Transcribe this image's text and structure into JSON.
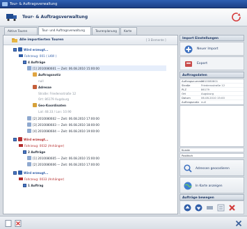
{
  "window": {
    "title": "Tour- & Auftragsverwaltung"
  },
  "header": {
    "title": "Tour- & Auftragsverwaltung"
  },
  "tabs": [
    {
      "label": "Aktive Touren"
    },
    {
      "label": "Tour- und Auftragsverwaltung"
    },
    {
      "label": "Tourenplanung"
    },
    {
      "label": "Karte"
    }
  ],
  "panel": {
    "title": "Alle importierten Touren",
    "tag": "[ 3 Elemente ]"
  },
  "tree": [
    {
      "text": "Wird erzeugt...",
      "cls": "blue bold"
    },
    {
      "text": "Fahrzeug: 001 ( LKW )",
      "cls": "blue"
    },
    {
      "text": "4 Aufträge",
      "cls": "bold"
    },
    {
      "text": "[1] 2010080601 — Zeit: 06.08.2010 15:00:00",
      "cls": ""
    },
    {
      "text": "Auftragsnotiz",
      "cls": "bold"
    },
    {
      "text": "null",
      "cls": "grey"
    },
    {
      "text": "Adresse",
      "cls": "bold"
    },
    {
      "text": "Straße: Friedensstraße 12",
      "cls": "grey"
    },
    {
      "text": "Ort: 86179 Augsburg",
      "cls": "grey"
    },
    {
      "text": "Geo-Koordinaten",
      "cls": "bold"
    },
    {
      "text": "Lat: 48.33 / Lon: 10.90",
      "cls": "grey"
    },
    {
      "text": "[2] 2010080602 — Zeit: 06.08.2010 17:00:00",
      "cls": ""
    },
    {
      "text": "[3] 2010080603 — Zeit: 06.08.2010 18:00:00",
      "cls": ""
    },
    {
      "text": "[4] 2010080604 — Zeit: 06.08.2010 19:00:00",
      "cls": ""
    },
    {
      "text": "Wird erzeugt...",
      "cls": "red bold"
    },
    {
      "text": "Fahrzeug: 0032 (Anhänger)",
      "cls": "red"
    },
    {
      "text": "2 Aufträge",
      "cls": "bold"
    },
    {
      "text": "[1] 2010080605 — Zeit: 06.08.2010 15:00:00",
      "cls": ""
    },
    {
      "text": "[2] 2010080606 — Zeit: 06.08.2010 17:00:00",
      "cls": ""
    },
    {
      "text": "Wird erzeugt...",
      "cls": "blue bold"
    },
    {
      "text": "Fahrzeug: 0033 (Anhänger)",
      "cls": "red"
    },
    {
      "text": "1 Auftrag",
      "cls": "bold"
    }
  ],
  "side": {
    "import_head": "Import Einstellungen",
    "new_import": "Neuer Import",
    "export": "Export",
    "details_head": "Auftragsdaten",
    "details": [
      {
        "k": "Auftragsnummer",
        "v": "2010080601"
      },
      {
        "k": "Straße",
        "v": "Friedensstraße 12"
      },
      {
        "k": "PLZ",
        "v": "86179"
      },
      {
        "k": "Ort",
        "v": "Augsburg"
      },
      {
        "k": "Datum",
        "v": "06.08.2010 15:00"
      },
      {
        "k": "Auftragsnotiz",
        "v": "null"
      }
    ],
    "field1": "Kunde",
    "field2": "Postfach",
    "addr_btn": "Adressen geocodieren",
    "map_btn": "In Karte anzeigen",
    "orders_head": "Aufträge bewegen"
  },
  "colors": {
    "accent": "#2f5da8",
    "titlebar": "#1c3f86",
    "warning": "#b52d2d"
  }
}
